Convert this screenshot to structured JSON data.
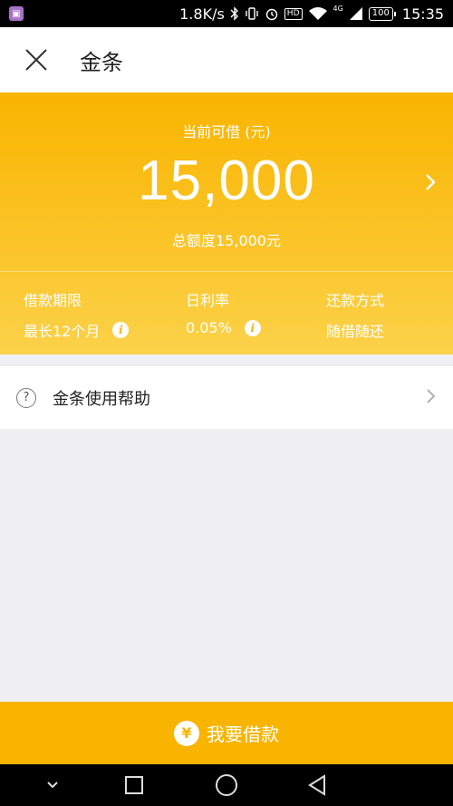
{
  "status_bar": {
    "network_speed": "1.8K/s",
    "network_type": "4G",
    "hd": "HD",
    "battery": "100",
    "time": "15:35",
    "icons": [
      "app-notification-icon",
      "bluetooth-icon",
      "vibrate-icon",
      "alarm-icon",
      "wifi-icon",
      "signal-icon"
    ]
  },
  "header": {
    "title": "金条",
    "close_icon": "close-icon"
  },
  "hero": {
    "label": "当前可借 (元)",
    "amount": "15,000",
    "total": "总额度15,000元",
    "colors": {
      "gradient_top": "#f9b400",
      "gradient_bottom": "#fbd24a"
    }
  },
  "info": [
    {
      "label": "借款期限",
      "value": "最长12个月",
      "has_info": true
    },
    {
      "label": "日利率",
      "value": "0.05%",
      "has_info": true
    },
    {
      "label": "还款方式",
      "value": "随借随还",
      "has_info": false
    }
  ],
  "help": {
    "label": "金条使用帮助",
    "icon": "question-icon"
  },
  "cta": {
    "label": "我要借款",
    "icon": "yen-icon",
    "color": "#f9b400"
  },
  "system_nav": [
    "back-down-icon",
    "recent-apps-icon",
    "home-icon",
    "back-icon"
  ]
}
